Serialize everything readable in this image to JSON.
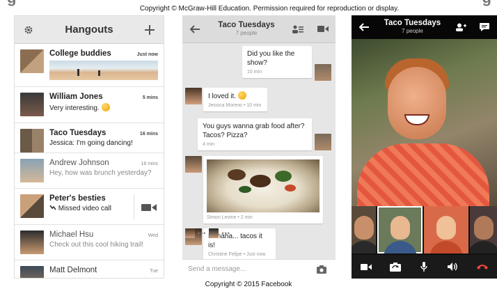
{
  "copyright_top": "Copyright © McGraw-Hill Education. Permission required for reproduction or display.",
  "copyright_bottom": "Copyright © 2015 Facebook",
  "phone1": {
    "title": "Hangouts",
    "icons": [
      "gear-icon",
      "plus-icon"
    ],
    "conversations": [
      {
        "name": "College buddies",
        "message": "",
        "time": "Just now",
        "unread": true,
        "has_photo": true
      },
      {
        "name": "William Jones",
        "message": "Very interesting.",
        "time": "5 mins",
        "unread": true,
        "emoji": true
      },
      {
        "name": "Taco Tuesdays",
        "message": "Jessica: I'm going dancing!",
        "time": "16 mins",
        "unread": true
      },
      {
        "name": "Andrew Johnson",
        "message": "Hey, how was brunch yesterday?",
        "time": "18 mins",
        "unread": false
      },
      {
        "name": "Peter's besties",
        "message": "Missed video call",
        "time": "",
        "unread": true,
        "video_call": true
      },
      {
        "name": "Michael Hsu",
        "message": "Check out this cool hiking trail!",
        "time": "Wed",
        "unread": false
      },
      {
        "name": "Matt Delmont",
        "message": "",
        "time": "Tue",
        "unread": false
      }
    ]
  },
  "phone2": {
    "title": "Taco Tuesdays",
    "subtitle": "7 people",
    "icons": [
      "back-arrow-icon",
      "people-list-icon",
      "video-camera-icon"
    ],
    "messages": [
      {
        "text": "Did you like the show?",
        "meta": "10 min"
      },
      {
        "text": "I loved it.",
        "meta": "Jessica Moreno • 10 min"
      },
      {
        "text": "You guys wanna grab food after? Tacos? Pizza?",
        "meta": "4 min"
      },
      {
        "text": "",
        "meta": "Simon Levine • 2 min"
      },
      {
        "text": "Hahaha... tacos it is!",
        "meta": "Christine Felipe • Just now"
      }
    ],
    "typing_dots": "•••",
    "compose_placeholder": "Send a message..."
  },
  "phone3": {
    "title": "Taco Tuesdays",
    "subtitle": "7 people",
    "icons": [
      "back-arrow-icon",
      "add-person-icon",
      "chat-icon"
    ],
    "controls": [
      "video-camera-icon",
      "switch-camera-icon",
      "microphone-icon",
      "speaker-icon",
      "hang-up-icon"
    ]
  },
  "colors": {
    "hangup": "#e8453c",
    "bubble": "#ffffff",
    "chat_bg": "#e6e6e6"
  }
}
